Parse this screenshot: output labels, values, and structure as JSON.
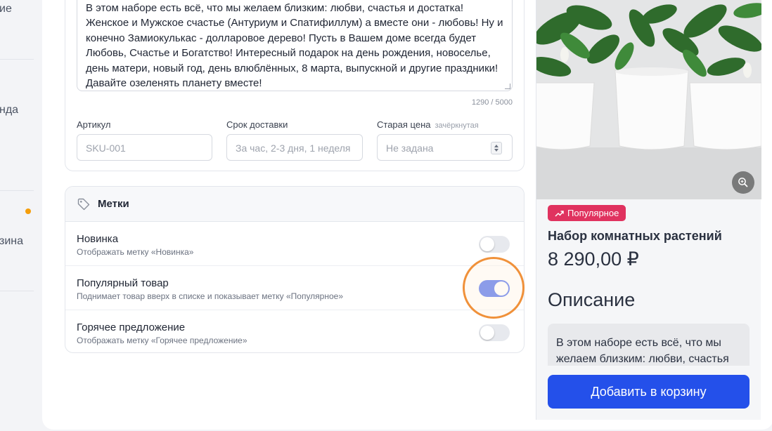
{
  "sidebar": {
    "items": [
      {
        "label": "ие"
      },
      {
        "label": "нда"
      },
      {
        "label": "зина"
      }
    ]
  },
  "description": {
    "text": "В этом наборе есть всё, что мы желаем близким: любви, счастья и достатка! Женское и Мужское счастье (Антуриум и Спатифиллум) а вместе они - любовь! Ну и конечно Замиокулькас - долларовое дерево! Пусть в Вашем доме всегда будет Любовь, Счастье и Богатство! Интересный подарок на день рождения, новоселье, день матери, новый год, день влюблённых, 8 марта, выпускной и другие праздники! Давайте озеленять планету вместе!",
    "counter": "1290 / 5000"
  },
  "fields": {
    "sku": {
      "label": "Артикул",
      "placeholder": "SKU-001"
    },
    "delivery": {
      "label": "Срок доставки",
      "placeholder": "За час, 2-3 дня, 1 неделя"
    },
    "old_price": {
      "label": "Старая цена",
      "hint": "зачёркнутая",
      "placeholder": "Не задана"
    }
  },
  "tags": {
    "title": "Метки",
    "items": [
      {
        "name": "Новинка",
        "desc": "Отображать метку «Новинка»",
        "on": false
      },
      {
        "name": "Популярный товар",
        "desc": "Поднимает товар вверх в списке и показывает метку «Популярное»",
        "on": true
      },
      {
        "name": "Горячее предложение",
        "desc": "Отображать метку «Горячее предложение»",
        "on": false
      }
    ]
  },
  "preview": {
    "badge": "Популярное",
    "title": "Набор комнатных растений",
    "price": "8 290,00 ₽",
    "desc_heading": "Описание",
    "desc_text": "В этом наборе есть всё, что мы желаем близким: любви, счастья",
    "cart_button": "Добавить в корзину"
  },
  "colors": {
    "accent": "#2450ea",
    "toggle_on": "#2f54eb",
    "badge": "#e0325f",
    "highlight": "#f0913a",
    "dot": "#f59e0b"
  }
}
